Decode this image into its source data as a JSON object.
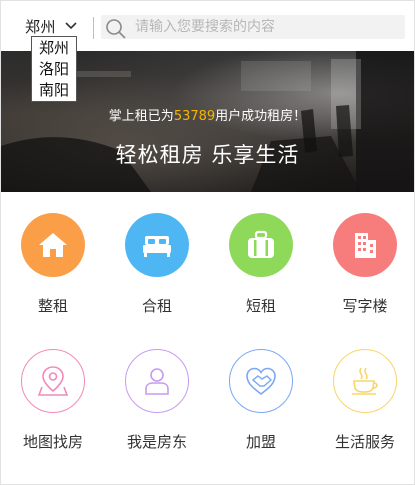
{
  "header": {
    "city": "郑州",
    "search_placeholder": "请输入您要搜索的内容"
  },
  "city_dropdown": {
    "options": [
      "郑州",
      "洛阳",
      "南阳"
    ]
  },
  "banner": {
    "subtitle_prefix": "掌上租已为",
    "subtitle_count": "53789",
    "subtitle_suffix": "用户成功租房！",
    "title": "轻松租房 乐享生活"
  },
  "categories": [
    {
      "label": "整租",
      "icon": "house-icon",
      "color": "#fb9e48"
    },
    {
      "label": "合租",
      "icon": "bed-icon",
      "color": "#4fb6f4"
    },
    {
      "label": "短租",
      "icon": "suitcase-icon",
      "color": "#8ed85a"
    },
    {
      "label": "写字楼",
      "icon": "building-icon",
      "color": "#f77c7c"
    },
    {
      "label": "地图找房",
      "icon": "map-pin-icon",
      "color": "#f28ab9"
    },
    {
      "label": "我是房东",
      "icon": "user-icon",
      "color": "#c59cf0"
    },
    {
      "label": "加盟",
      "icon": "handshake-heart-icon",
      "color": "#7ba8f2"
    },
    {
      "label": "生活服务",
      "icon": "coffee-cup-icon",
      "color": "#f8d56a"
    }
  ]
}
